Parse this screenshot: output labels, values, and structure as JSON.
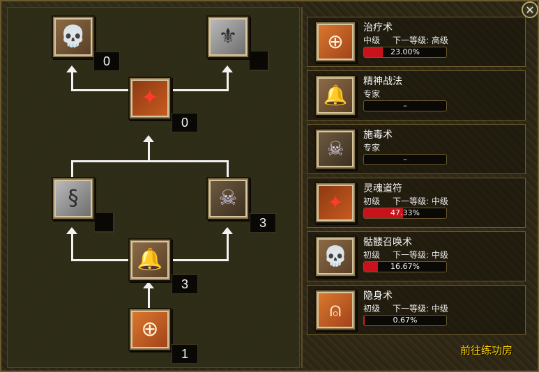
{
  "tree": {
    "nodes": [
      {
        "id": "skeleton-top",
        "icon": "skull-icon",
        "glyph": "💀",
        "style": "skull",
        "count": "0"
      },
      {
        "id": "stone-top",
        "icon": "stone-rune-icon",
        "glyph": "⚜",
        "style": "gray",
        "count": ""
      },
      {
        "id": "soul-mid",
        "icon": "soul-talisman-icon",
        "glyph": "✦",
        "style": "red",
        "count": "0"
      },
      {
        "id": "stone-left",
        "icon": "stone-rune-icon",
        "glyph": "§",
        "style": "gray",
        "count": ""
      },
      {
        "id": "poison-right",
        "icon": "poison-skull-icon",
        "glyph": "☠",
        "style": "dark",
        "count": "3"
      },
      {
        "id": "bell-mid",
        "icon": "spirit-bell-icon",
        "glyph": "🔔",
        "style": "purple",
        "count": "3"
      },
      {
        "id": "heal-bottom",
        "icon": "healing-cross-icon",
        "glyph": "⊕",
        "style": "orange",
        "count": "1"
      }
    ]
  },
  "skills": [
    {
      "name": "治疗术",
      "level": "中级",
      "next": "下一等级: 高级",
      "progress": 0.23,
      "bar_text": "23.00%",
      "icon": "healing-cross-icon",
      "glyph": "⊕",
      "style": "orange"
    },
    {
      "name": "精神战法",
      "level": "专家",
      "next": "",
      "progress": 0,
      "bar_text": "–",
      "icon": "spirit-bell-icon",
      "glyph": "🔔",
      "style": "purple"
    },
    {
      "name": "施毒术",
      "level": "专家",
      "next": "",
      "progress": 0,
      "bar_text": "–",
      "icon": "poison-skull-icon",
      "glyph": "☠",
      "style": "dark"
    },
    {
      "name": "灵魂道符",
      "level": "初级",
      "next": "下一等级: 中级",
      "progress": 0.4733,
      "bar_text": "47.33%",
      "icon": "soul-talisman-icon",
      "glyph": "✦",
      "style": "red"
    },
    {
      "name": "骷髅召唤术",
      "level": "初级",
      "next": "下一等级: 中级",
      "progress": 0.1667,
      "bar_text": "16.67%",
      "icon": "skull-icon",
      "glyph": "💀",
      "style": "skull"
    },
    {
      "name": "隐身术",
      "level": "初级",
      "next": "下一等级: 中级",
      "progress": 0.0067,
      "bar_text": "0.67%",
      "icon": "stealth-rune-icon",
      "glyph": "⍝",
      "style": "orange"
    }
  ],
  "goto_label": "前往练功房",
  "close_label": "✕",
  "colors": {
    "progress": "#c8121c",
    "link": "#ffd400"
  }
}
